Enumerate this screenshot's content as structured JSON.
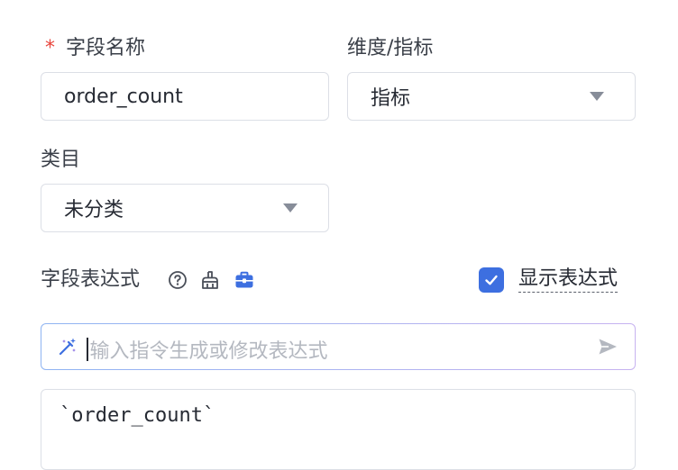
{
  "form": {
    "field_name": {
      "required_mark": "*",
      "label": "字段名称",
      "value": "order_count"
    },
    "dimension_metric": {
      "label": "维度/指标",
      "selected": "指标"
    },
    "category": {
      "label": "类目",
      "selected": "未分类"
    },
    "expression": {
      "label": "字段表达式",
      "show_expression_label": "显示表达式",
      "show_expression_checked": true,
      "ai_placeholder": "输入指令生成或修改表达式",
      "code": "`order_count`"
    }
  },
  "colors": {
    "accent": "#3d6fe0",
    "required": "#e8453c",
    "border": "#dcdfe6",
    "placeholder": "#b4b8c0"
  },
  "icons": {
    "help": "help-circle-icon",
    "clear": "broom-icon",
    "toolbox": "toolbox-icon",
    "ai_wand": "magic-wand-icon",
    "send": "send-icon",
    "dropdown": "chevron-down-icon",
    "check": "check-icon"
  }
}
